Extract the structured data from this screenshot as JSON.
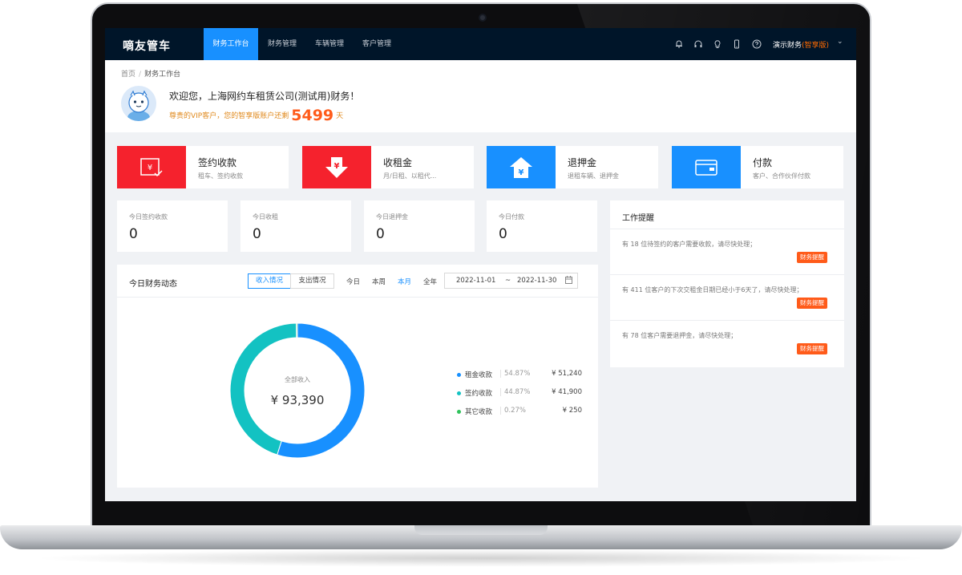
{
  "app": {
    "logo": "嘀友管车"
  },
  "nav": {
    "tabs": [
      {
        "label": "财务工作台",
        "active": true
      },
      {
        "label": "财务管理",
        "active": false
      },
      {
        "label": "车辆管理",
        "active": false
      },
      {
        "label": "客户管理",
        "active": false
      }
    ],
    "icons": [
      "bell-icon",
      "headset-icon",
      "lightbulb-icon",
      "mobile-icon",
      "help-icon"
    ],
    "user": {
      "name": "演示财务",
      "plan": "(智享版)"
    }
  },
  "breadcrumb": {
    "home": "首页",
    "separator": "/",
    "current": "财务工作台"
  },
  "welcome": {
    "greeting": "欢迎您，上海网约车租赁公司(测试用)财务！",
    "vip_prefix": "尊贵的VIP客户，您的智享版账户还剩",
    "vip_days": "5499",
    "vip_suffix": "天"
  },
  "actions": [
    {
      "title": "签约收款",
      "sub": "租车、签约收款",
      "color": "#f5222d",
      "icon": "yen-check-icon"
    },
    {
      "title": "收租金",
      "sub": "月/日租、以租代...",
      "color": "#f5222d",
      "icon": "yen-down-icon"
    },
    {
      "title": "退押金",
      "sub": "退租车辆、退押金",
      "color": "#1890ff",
      "icon": "deposit-return-icon"
    },
    {
      "title": "付款",
      "sub": "客户、合作伙伴付款",
      "color": "#1890ff",
      "icon": "wallet-icon"
    }
  ],
  "stats": [
    {
      "label": "今日签约收款",
      "value": "0"
    },
    {
      "label": "今日收租",
      "value": "0"
    },
    {
      "label": "今日退押金",
      "value": "0"
    },
    {
      "label": "今日付款",
      "value": "0"
    }
  ],
  "finance": {
    "title": "今日财务动态",
    "segments": [
      {
        "label": "收入情况",
        "active": true
      },
      {
        "label": "支出情况",
        "active": false
      }
    ],
    "ranges": [
      {
        "label": "今日",
        "active": false
      },
      {
        "label": "本周",
        "active": false
      },
      {
        "label": "本月",
        "active": true
      },
      {
        "label": "全年",
        "active": false
      }
    ],
    "date_start": "2022-11-01",
    "date_sep": "~",
    "date_end": "2022-11-30",
    "donut_label": "全部收入",
    "donut_total": "¥ 93,390"
  },
  "chart_data": {
    "type": "pie",
    "categories": [
      "租金收款",
      "签约收款",
      "其它收款"
    ],
    "values": [
      51240,
      41900,
      250
    ],
    "percent_labels": [
      "54.87%",
      "44.87%",
      "0.27%"
    ],
    "amount_labels": [
      "¥ 51,240",
      "¥ 41,900",
      "¥ 250"
    ],
    "colors": [
      "#1890ff",
      "#13c2c2",
      "#2fc25b"
    ],
    "center_label": "全部收入",
    "center_total": "¥ 93,390",
    "legend_position": "right"
  },
  "reminders": {
    "title": "工作提醒",
    "items": [
      {
        "text": "有 18 位待签约的客户需要收款，请尽快处理；",
        "tag": "财务提醒"
      },
      {
        "text": "有 411 位客户的下次交租金日期已经小于6天了，请尽快处理；",
        "tag": "财务提醒"
      },
      {
        "text": "有 78 位客户需要退押金，请尽快处理；",
        "tag": "财务提醒"
      }
    ]
  }
}
